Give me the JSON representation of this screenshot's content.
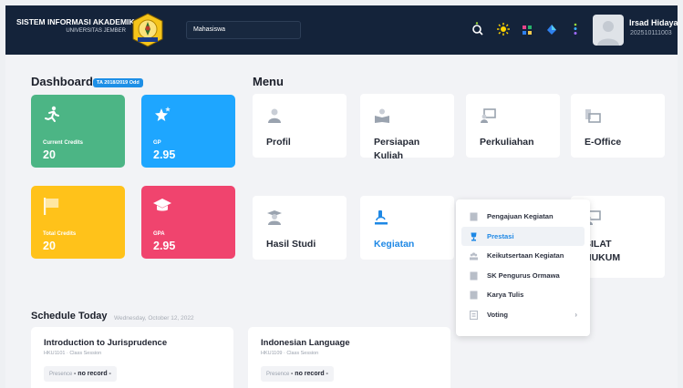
{
  "header": {
    "title": "SISTEM INFORMASI AKADEMIK",
    "subtitle": "UNIVERSITAS JEMBER",
    "role": "Mahasiswa",
    "user_name": "Irsad Hidayat",
    "user_id": "202510111003",
    "icons": [
      "search-icon",
      "sun-icon",
      "apps-icon",
      "diamond-icon",
      "dots-icon"
    ]
  },
  "dashboard": {
    "title": "Dashboard",
    "badge": "TA 2018/2019 Odd",
    "stats": [
      {
        "label": "Current Credits",
        "value": "20",
        "color": "#4cb585",
        "icon": "runner-icon"
      },
      {
        "label": "GP",
        "value": "2.95",
        "color": "#1ea6ff",
        "icon": "star-icon"
      },
      {
        "label": "Total Credits",
        "value": "20",
        "color": "#ffc21a",
        "icon": "flag-icon"
      },
      {
        "label": "GPA",
        "value": "2.95",
        "color": "#f0446e",
        "icon": "graduation-cap-icon"
      }
    ]
  },
  "menu": {
    "title": "Menu",
    "items": [
      {
        "label": "Profil",
        "icon": "user-icon"
      },
      {
        "label": "Persiapan Kuliah",
        "icon": "reading-icon"
      },
      {
        "label": "Perkuliahan",
        "icon": "presentation-icon"
      },
      {
        "label": "E-Office",
        "icon": "office-icon"
      },
      {
        "label": "Hasil Studi",
        "icon": "graduate-icon"
      },
      {
        "label": "Kegiatan",
        "icon": "microscope-icon"
      },
      {
        "label": "SILAT HUKUM",
        "icon": "presentation-icon"
      }
    ]
  },
  "kegiatan_dropdown": [
    {
      "label": "Pengajuan Kegiatan"
    },
    {
      "label": "Prestasi"
    },
    {
      "label": "Keikutsertaan Kegiatan"
    },
    {
      "label": "SK Pengurus Ormawa"
    },
    {
      "label": "Karya Tulis"
    },
    {
      "label": "Voting",
      "chevron": "›"
    }
  ],
  "schedule": {
    "title": "Schedule Today",
    "date": "Wednesday, October 12, 2022",
    "courses": [
      {
        "name": "Introduction to Jurisprudence",
        "code": "HKU1101 · Class Session",
        "presence_label": "Presence",
        "presence_value": "- no record -"
      },
      {
        "name": "Indonesian Language",
        "code": "HKU1109 · Class Session",
        "presence_label": "Presence",
        "presence_value": "- no record -"
      }
    ]
  },
  "colors": {
    "topbar": "#14233a",
    "accent": "#1e88e5"
  }
}
